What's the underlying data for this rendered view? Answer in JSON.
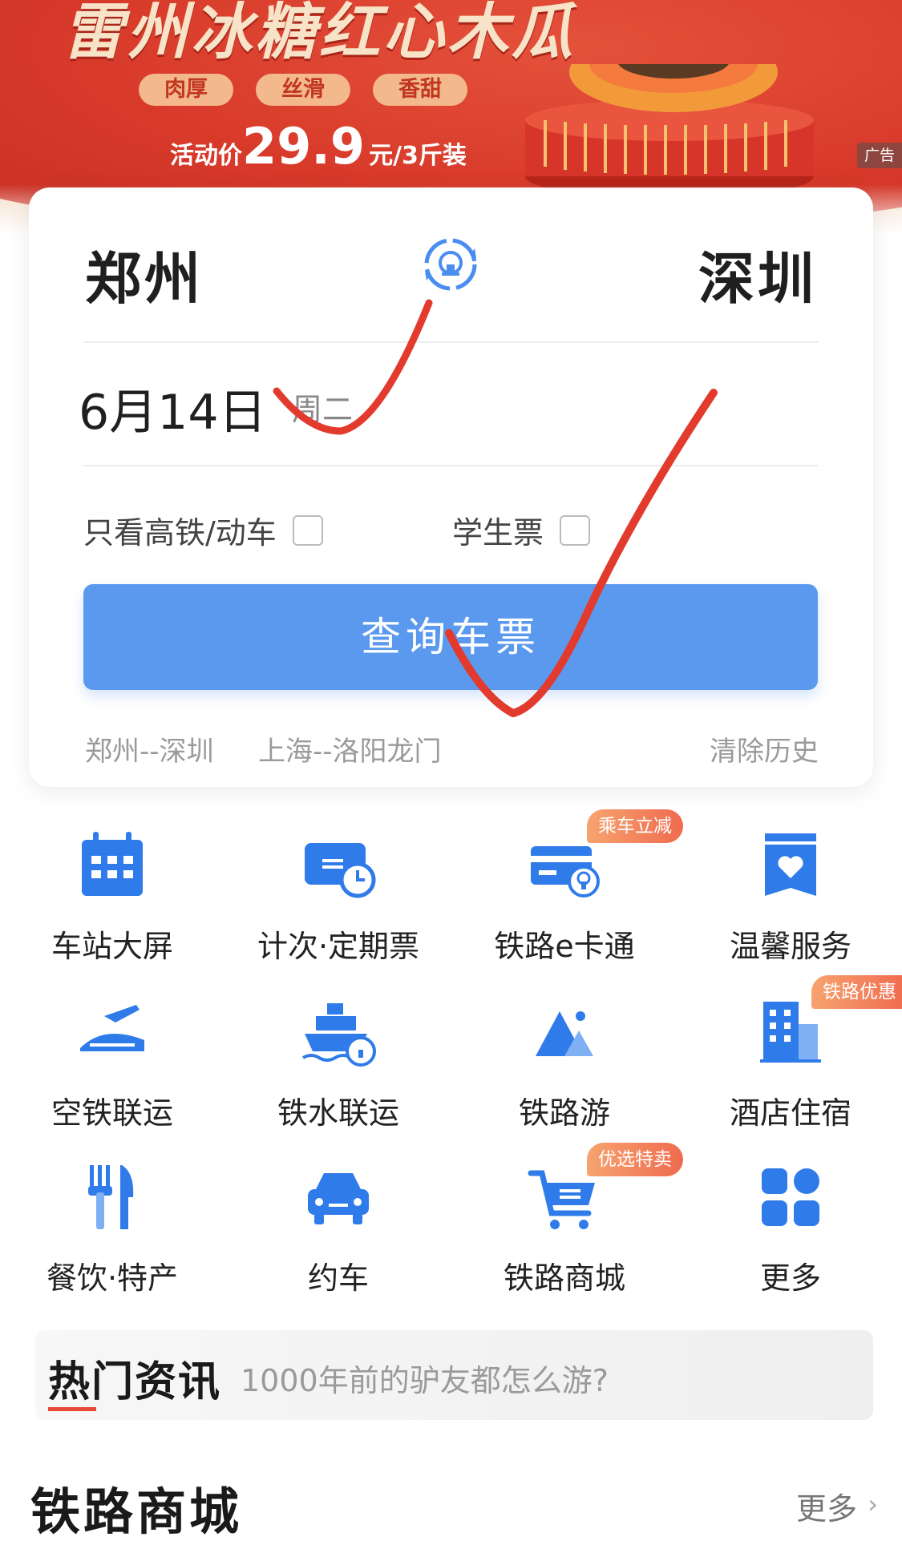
{
  "banner": {
    "title": "雷州冰糖红心木瓜",
    "tags": [
      "肉厚",
      "丝滑",
      "香甜"
    ],
    "price_label": "活动价",
    "price_value": "29.9",
    "price_unit": "元/3斤装",
    "ad_label": "广告"
  },
  "search": {
    "from_city": "郑州",
    "to_city": "深圳",
    "date": "6月14日",
    "weekday": "周二",
    "option_high_speed": "只看高铁/动车",
    "option_student": "学生票",
    "query_button": "查询车票",
    "history_1": "郑州--深圳",
    "history_2": "上海--洛阳龙门",
    "clear_history": "清除历史"
  },
  "services": [
    {
      "label": "车站大屏",
      "icon": "station-screen-icon"
    },
    {
      "label": "计次·定期票",
      "icon": "period-ticket-icon"
    },
    {
      "label": "铁路e卡通",
      "icon": "railway-card-icon",
      "badge": "乘车立减"
    },
    {
      "label": "温馨服务",
      "icon": "heart-service-icon"
    },
    {
      "label": "空铁联运",
      "icon": "air-rail-icon"
    },
    {
      "label": "铁水联运",
      "icon": "ship-rail-icon"
    },
    {
      "label": "铁路游",
      "icon": "mountain-travel-icon"
    },
    {
      "label": "酒店住宿",
      "icon": "hotel-icon",
      "badge": "铁路优惠"
    },
    {
      "label": "餐饮·特产",
      "icon": "dining-icon"
    },
    {
      "label": "约车",
      "icon": "car-icon"
    },
    {
      "label": "铁路商城",
      "icon": "shopping-cart-icon",
      "badge": "优选特卖"
    },
    {
      "label": "更多",
      "icon": "more-grid-icon"
    }
  ],
  "news": {
    "title": "热门资讯",
    "headline": "1000年前的驴友都怎么游?"
  },
  "mall": {
    "title": "铁路商城",
    "more": "更多"
  },
  "colors": {
    "primary_blue": "#5b99ef",
    "icon_blue": "#2f7bea",
    "badge_orange": "#ef6b4f",
    "banner_red": "#d83a2a",
    "ink_red": "#e23b2e"
  }
}
